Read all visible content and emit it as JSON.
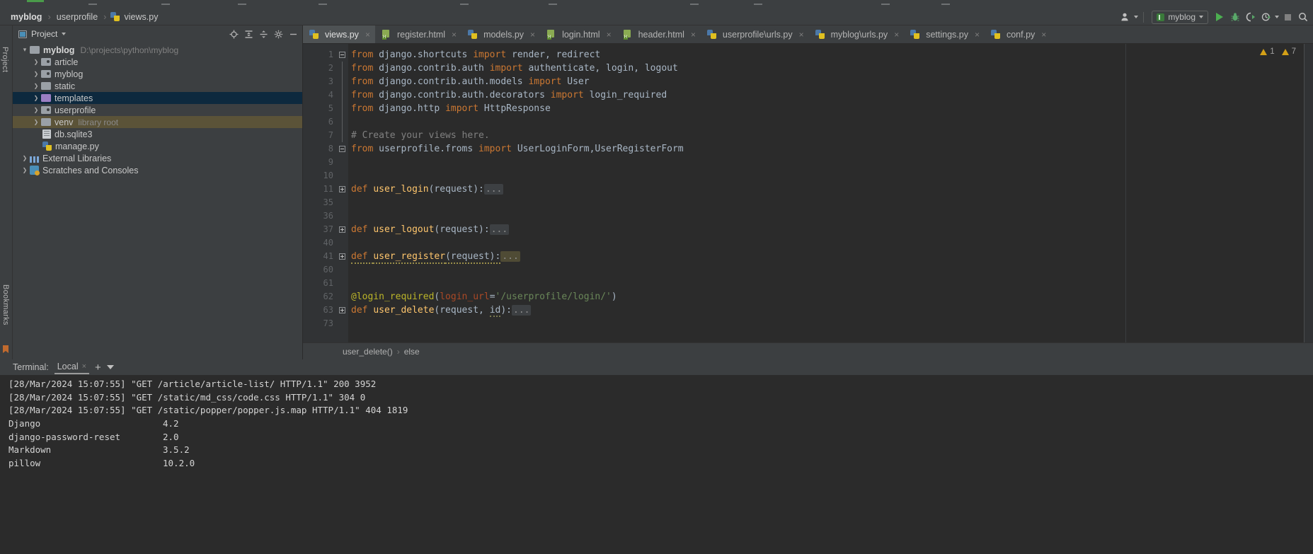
{
  "window": {
    "title": "myblog"
  },
  "breadcrumb": {
    "items": [
      {
        "label": "myblog",
        "icon": "none"
      },
      {
        "label": "userprofile",
        "icon": "none"
      },
      {
        "label": "views.py",
        "icon": "python-file-icon"
      }
    ],
    "separator": "›"
  },
  "toolbar": {
    "user_icon": "user-avatar-icon",
    "run_config": {
      "label": "myblog",
      "icon": "run-config-icon"
    },
    "buttons": [
      {
        "name": "run-button",
        "icon": "play-icon",
        "color": "#4caf50"
      },
      {
        "name": "debug-button",
        "icon": "bug-icon",
        "color": "#4caf50"
      },
      {
        "name": "run-with-coverage-button",
        "icon": "coverage-icon",
        "color": "#4caf50"
      },
      {
        "name": "profile-button",
        "icon": "clock-run-icon",
        "color": "#4caf50"
      },
      {
        "name": "stop-button",
        "icon": "stop-square-icon",
        "color": "#808080"
      },
      {
        "name": "search-everywhere-button",
        "icon": "search-icon",
        "color": "#b0b0b0"
      }
    ]
  },
  "sidebar": {
    "strip_label_top": "Project",
    "strip_label_bottom": "Bookmarks",
    "header": {
      "title": "Project",
      "icon": "project-view-icon"
    },
    "header_actions": [
      {
        "name": "locate-file-icon",
        "glyph": "⌖"
      },
      {
        "name": "expand-all-icon",
        "glyph": "⨌"
      },
      {
        "name": "collapse-all-icon",
        "glyph": "⨋"
      },
      {
        "name": "settings-gear-icon",
        "glyph": "⚙"
      },
      {
        "name": "hide-panel-icon",
        "glyph": "—"
      }
    ],
    "tree": [
      {
        "label": "myblog",
        "path": "D:\\projects\\python\\myblog",
        "depth": 0,
        "arrow": "down",
        "icon": "folder-icon",
        "bold": true,
        "highlight": "none"
      },
      {
        "label": "article",
        "depth": 1,
        "arrow": "right",
        "icon": "module-folder-icon",
        "highlight": "none"
      },
      {
        "label": "myblog",
        "depth": 1,
        "arrow": "right",
        "icon": "module-folder-icon",
        "highlight": "none"
      },
      {
        "label": "static",
        "depth": 1,
        "arrow": "right",
        "icon": "folder-icon",
        "highlight": "none"
      },
      {
        "label": "templates",
        "depth": 1,
        "arrow": "right",
        "icon": "template-folder-icon",
        "highlight": "blue"
      },
      {
        "label": "userprofile",
        "depth": 1,
        "arrow": "right",
        "icon": "module-folder-icon",
        "highlight": "none"
      },
      {
        "label": "venv",
        "tag": "library root",
        "depth": 1,
        "arrow": "right",
        "icon": "folder-icon",
        "highlight": "tan"
      },
      {
        "label": "db.sqlite3",
        "depth": 2,
        "arrow": "none",
        "icon": "database-file-icon",
        "highlight": "none"
      },
      {
        "label": "manage.py",
        "depth": 2,
        "arrow": "none",
        "icon": "python-file-icon",
        "highlight": "none"
      },
      {
        "label": "External Libraries",
        "depth": 0,
        "arrow": "right",
        "icon": "library-icon",
        "highlight": "none"
      },
      {
        "label": "Scratches and Consoles",
        "depth": 0,
        "arrow": "right",
        "icon": "scratches-icon",
        "highlight": "none"
      }
    ]
  },
  "editor": {
    "tabs": [
      {
        "label": "views.py",
        "icon": "python-file-icon",
        "active": true,
        "close": "×"
      },
      {
        "label": "register.html",
        "icon": "html-file-icon",
        "active": false,
        "close": "×"
      },
      {
        "label": "models.py",
        "icon": "python-file-icon",
        "active": false,
        "close": "×"
      },
      {
        "label": "login.html",
        "icon": "html-file-icon",
        "active": false,
        "close": "×"
      },
      {
        "label": "header.html",
        "icon": "html-file-icon",
        "active": false,
        "close": "×"
      },
      {
        "label": "userprofile\\urls.py",
        "icon": "python-file-icon",
        "active": false,
        "close": "×"
      },
      {
        "label": "myblog\\urls.py",
        "icon": "python-file-icon",
        "active": false,
        "close": "×"
      },
      {
        "label": "settings.py",
        "icon": "python-file-icon",
        "active": false,
        "close": "×"
      },
      {
        "label": "conf.py",
        "icon": "python-file-icon",
        "active": false,
        "close": "×"
      }
    ],
    "warnings": {
      "error_count": "1",
      "warning_count": "7"
    },
    "line_numbers": [
      "1",
      "2",
      "3",
      "4",
      "5",
      "6",
      "7",
      "8",
      "9",
      "10",
      "11",
      "35",
      "36",
      "37",
      "40",
      "41",
      "60",
      "61",
      "62",
      "63",
      "73"
    ],
    "status_bar": {
      "func": "user_delete()",
      "sep": "›",
      "branch": "else"
    }
  },
  "code_lines": [
    {
      "n": "1",
      "fold": "minus",
      "tokens": [
        {
          "t": "from ",
          "c": "kw"
        },
        {
          "t": "django.shortcuts ",
          "c": "id"
        },
        {
          "t": "import ",
          "c": "kw"
        },
        {
          "t": "render, redirect",
          "c": "id"
        }
      ]
    },
    {
      "n": "2",
      "fold": "bar",
      "tokens": [
        {
          "t": "from ",
          "c": "kw"
        },
        {
          "t": "django.contrib.auth ",
          "c": "id"
        },
        {
          "t": "import ",
          "c": "kw"
        },
        {
          "t": "authenticate, login, logout",
          "c": "id"
        }
      ]
    },
    {
      "n": "3",
      "fold": "bar",
      "tokens": [
        {
          "t": "from ",
          "c": "kw"
        },
        {
          "t": "django.contrib.auth.models ",
          "c": "id"
        },
        {
          "t": "import ",
          "c": "kw"
        },
        {
          "t": "User",
          "c": "id"
        }
      ]
    },
    {
      "n": "4",
      "fold": "bar",
      "tokens": [
        {
          "t": "from ",
          "c": "kw"
        },
        {
          "t": "django.contrib.auth.decorators ",
          "c": "id"
        },
        {
          "t": "import ",
          "c": "kw"
        },
        {
          "t": "login_required",
          "c": "id"
        }
      ]
    },
    {
      "n": "5",
      "fold": "bar",
      "tokens": [
        {
          "t": "from ",
          "c": "kw"
        },
        {
          "t": "django.http ",
          "c": "id"
        },
        {
          "t": "import ",
          "c": "kw"
        },
        {
          "t": "HttpResponse",
          "c": "id"
        }
      ]
    },
    {
      "n": "6",
      "fold": "bar",
      "tokens": []
    },
    {
      "n": "7",
      "fold": "bar",
      "tokens": [
        {
          "t": "# Create your views here.",
          "c": "cmt"
        }
      ]
    },
    {
      "n": "8",
      "fold": "minus",
      "tokens": [
        {
          "t": "from ",
          "c": "kw"
        },
        {
          "t": "userprofile.froms ",
          "c": "id"
        },
        {
          "t": "import ",
          "c": "kw"
        },
        {
          "t": "UserLoginForm,UserRegisterForm",
          "c": "id"
        }
      ]
    },
    {
      "n": "9",
      "fold": "none",
      "tokens": []
    },
    {
      "n": "10",
      "fold": "none",
      "tokens": []
    },
    {
      "n": "11",
      "fold": "plus",
      "tokens": [
        {
          "t": "def ",
          "c": "kw"
        },
        {
          "t": "user_login",
          "c": "fn"
        },
        {
          "t": "(request):",
          "c": "id"
        },
        {
          "t": "...",
          "c": "fold"
        }
      ]
    },
    {
      "n": "35",
      "fold": "none",
      "tokens": []
    },
    {
      "n": "36",
      "fold": "none",
      "tokens": []
    },
    {
      "n": "37",
      "fold": "plus",
      "tokens": [
        {
          "t": "def ",
          "c": "kw"
        },
        {
          "t": "user_logout",
          "c": "fn"
        },
        {
          "t": "(request):",
          "c": "id"
        },
        {
          "t": "...",
          "c": "fold"
        }
      ]
    },
    {
      "n": "40",
      "fold": "none",
      "tokens": []
    },
    {
      "n": "41",
      "fold": "plus",
      "tokens": [
        {
          "t": "def ",
          "c": "kw squig"
        },
        {
          "t": "user_register",
          "c": "fn squig"
        },
        {
          "t": "(request):",
          "c": "id squig"
        },
        {
          "t": "...",
          "c": "fold hl"
        }
      ]
    },
    {
      "n": "60",
      "fold": "none",
      "tokens": []
    },
    {
      "n": "61",
      "fold": "none",
      "tokens": []
    },
    {
      "n": "62",
      "fold": "none",
      "tokens": [
        {
          "t": "@login_required",
          "c": "dec"
        },
        {
          "t": "(",
          "c": "id"
        },
        {
          "t": "login_url",
          "c": "param"
        },
        {
          "t": "=",
          "c": "id"
        },
        {
          "t": "'/userprofile/login/'",
          "c": "str"
        },
        {
          "t": ")",
          "c": "id"
        }
      ]
    },
    {
      "n": "63",
      "fold": "plus",
      "tokens": [
        {
          "t": "def ",
          "c": "kw"
        },
        {
          "t": "user_delete",
          "c": "fn"
        },
        {
          "t": "(request, ",
          "c": "id"
        },
        {
          "t": "id",
          "c": "id squig2"
        },
        {
          "t": "):",
          "c": "id"
        },
        {
          "t": "...",
          "c": "fold"
        }
      ]
    },
    {
      "n": "73",
      "fold": "none",
      "tokens": []
    }
  ],
  "terminal": {
    "label": "Terminal:",
    "tab": {
      "label": "Local",
      "close": "×"
    },
    "add_button": "+",
    "dropdown_icon": "chevron-down-icon",
    "lines": [
      {
        "text": "[28/Mar/2024 15:07:55] \"GET /article/article-list/ HTTP/1.1\" 200 3952"
      },
      {
        "text": "[28/Mar/2024 15:07:55] \"GET /static/md_css/code.css HTTP/1.1\" 304 0"
      },
      {
        "text": "[28/Mar/2024 15:07:55] \"GET /static/popper/popper.js.map HTTP/1.1\" 404 1819"
      }
    ],
    "packages": [
      {
        "name": "Django",
        "version": "4.2"
      },
      {
        "name": "django-password-reset",
        "version": "2.0"
      },
      {
        "name": "Markdown",
        "version": "3.5.2"
      },
      {
        "name": "pillow",
        "version": "10.2.0"
      }
    ]
  }
}
